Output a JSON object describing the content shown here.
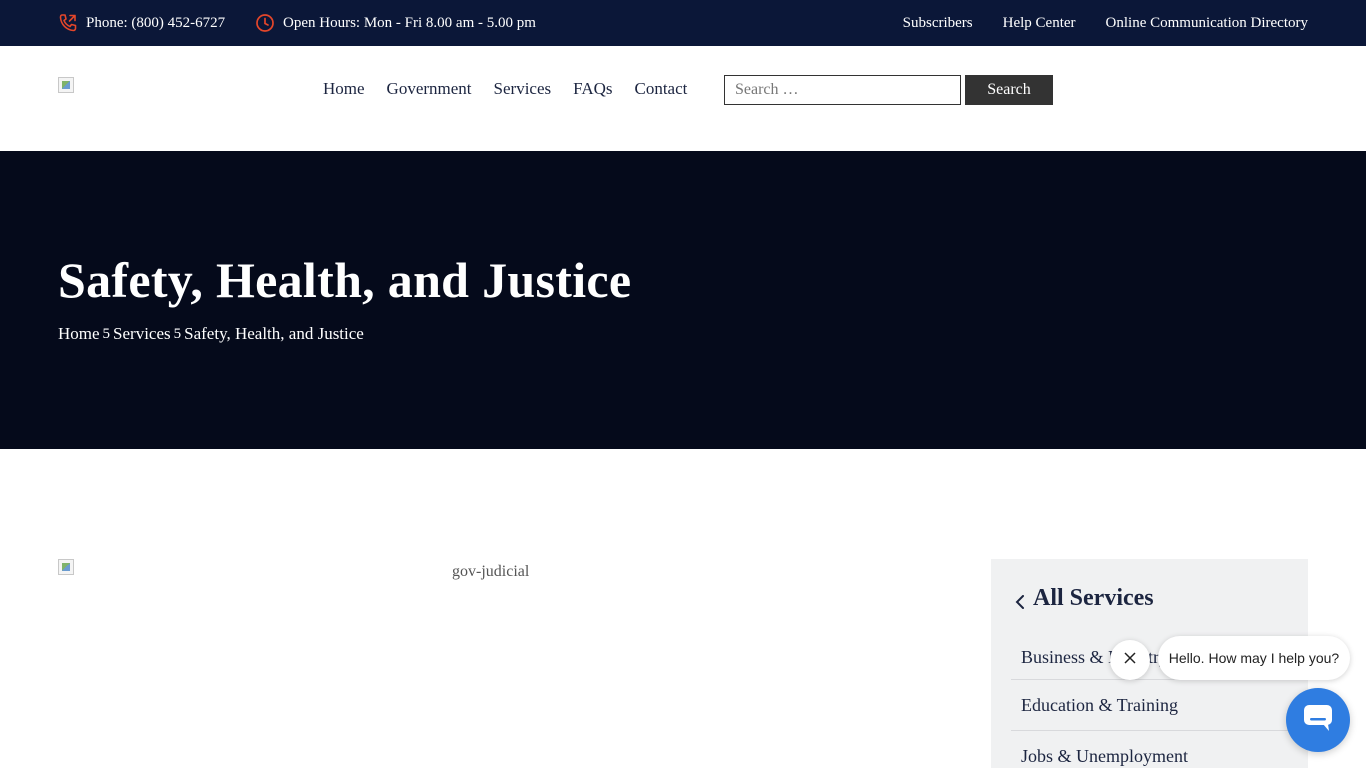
{
  "topbar": {
    "phone": "Phone: (800) 452-6727",
    "hours": "Open Hours: Mon - Fri 8.00 am - 5.00 pm",
    "links": [
      "Subscribers",
      "Help Center",
      "Online Communication Directory"
    ]
  },
  "header": {
    "nav": [
      "Home",
      "Government",
      "Services",
      "FAQs",
      "Contact"
    ],
    "search": {
      "placeholder": "Search …",
      "button": "Search"
    }
  },
  "hero": {
    "title": "Safety, Health, and Justice",
    "breadcrumb": [
      "Home",
      "Services",
      "Safety, Health, and Justice"
    ],
    "separator": "5"
  },
  "content": {
    "image_alt": "gov-judicial"
  },
  "sidebar": {
    "title": "All Services",
    "items": [
      "Business & Industry",
      "Education & Training",
      "Jobs & Unemployment"
    ]
  },
  "chat": {
    "message": "Hello. How may I help you?"
  },
  "colors": {
    "topbar": "#0b1738",
    "hero": "#050a1b",
    "accent_icon": "#e4462a",
    "chat": "#2f7de1"
  },
  "icons": {
    "phone": "phone-icon",
    "hours": "clock-icon",
    "back": "chevron-left-icon",
    "close": "close-icon",
    "chat": "chat-icon"
  }
}
